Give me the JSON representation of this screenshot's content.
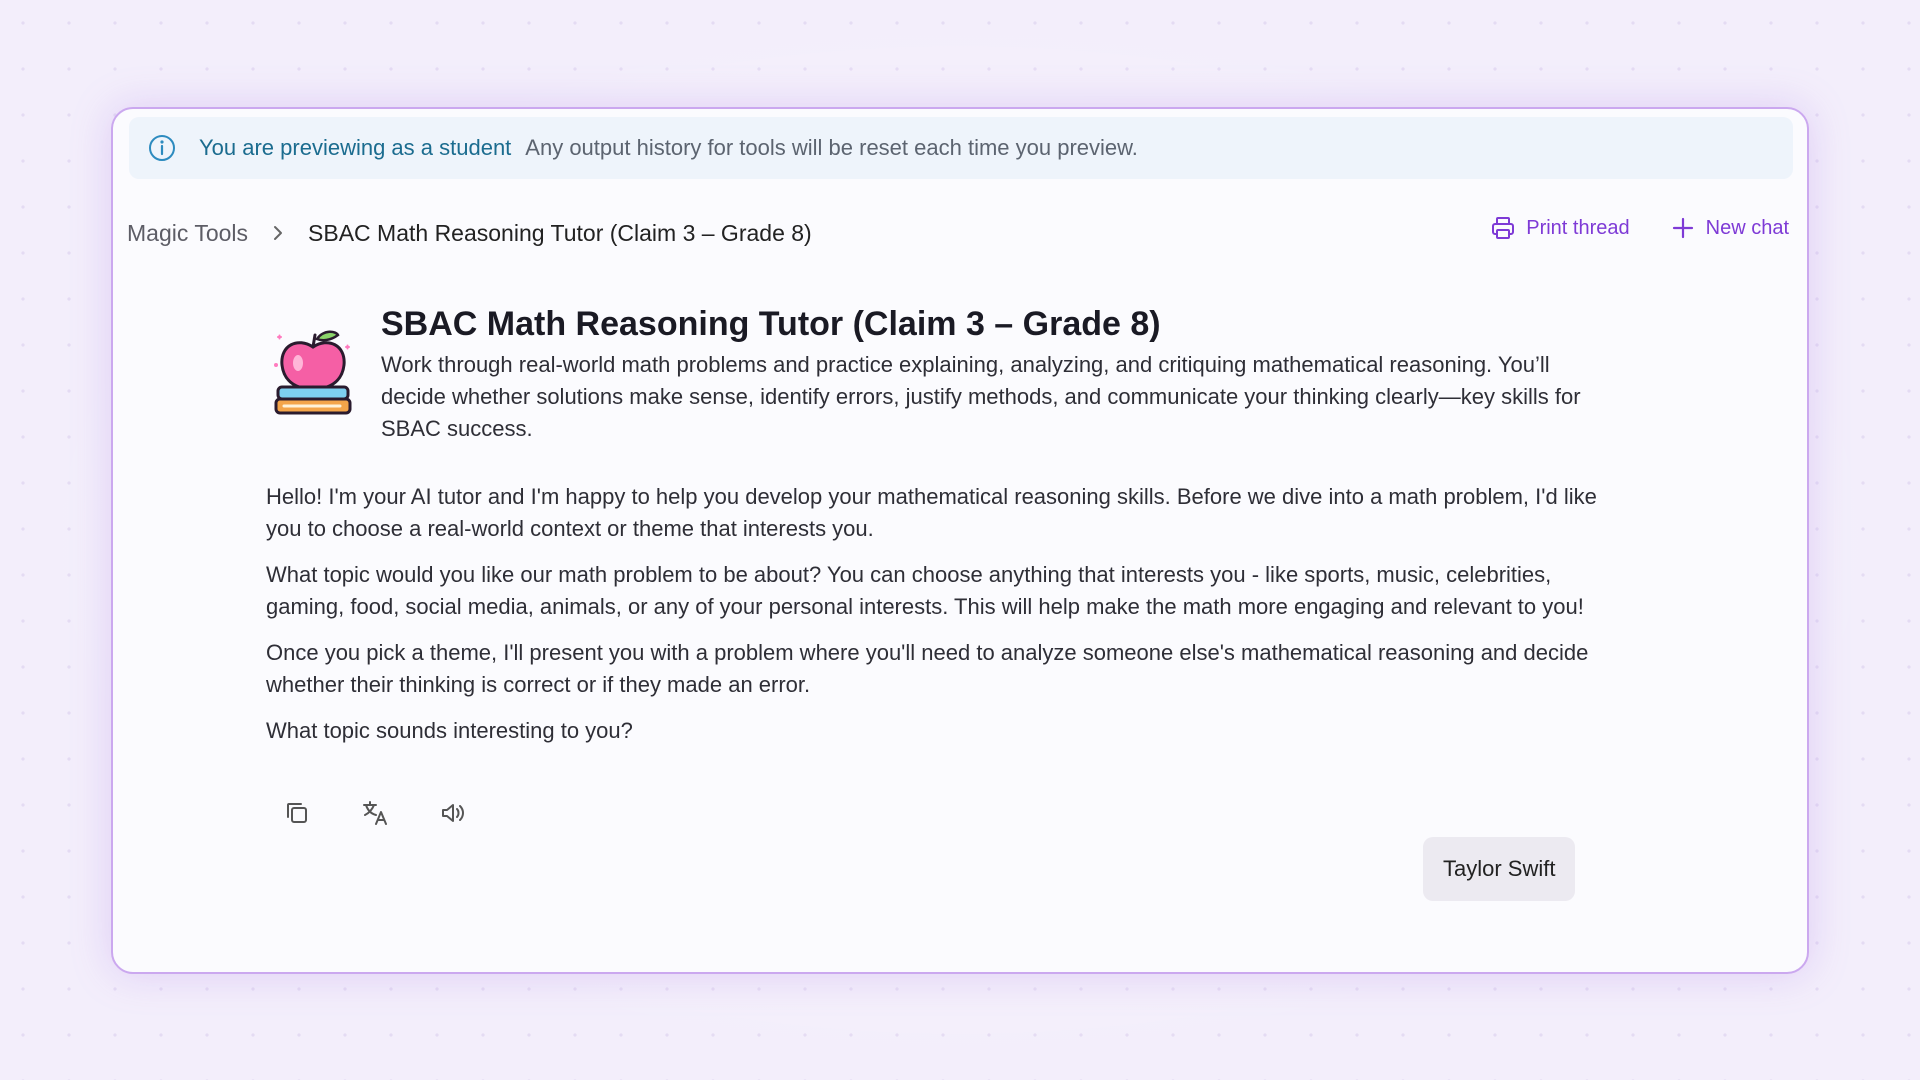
{
  "banner": {
    "icon": "info-icon",
    "strong_text": "You are previewing as a student",
    "muted_text": "Any output history for tools will be reset each time you preview."
  },
  "breadcrumb": {
    "items": [
      "Magic Tools",
      "SBAC Math Reasoning Tutor (Claim 3 – Grade 8)"
    ]
  },
  "actions": {
    "print_label": "Print thread",
    "new_chat_label": "New chat"
  },
  "tool": {
    "title": "SBAC Math Reasoning Tutor (Claim 3 – Grade 8)",
    "description": "Work through real-world math problems and practice explaining, analyzing, and critiquing mathematical reasoning. You’ll decide whether solutions make sense, identify errors, justify methods, and communicate your thinking clearly—key skills for SBAC success."
  },
  "assistant_message": {
    "paragraphs": [
      "Hello! I'm your AI tutor and I'm happy to help you develop your mathematical reasoning skills. Before we dive into a math problem, I'd like you to choose a real-world context or theme that interests you.",
      "What topic would you like our math problem to be about? You can choose anything that interests you - like sports, music, celebrities, gaming, food, social media, animals, or any of your personal interests. This will help make the math more engaging and relevant to you!",
      "Once you pick a theme, I'll present you with a problem where you'll need to analyze someone else's mathematical reasoning and decide whether their thinking is correct or if they made an error.",
      "What topic sounds interesting to you?"
    ]
  },
  "user_message": "Taylor Swift",
  "colors": {
    "accent": "#7e3ad6",
    "banner_text": "#1b6c8f",
    "card_border": "#cba8ef"
  }
}
